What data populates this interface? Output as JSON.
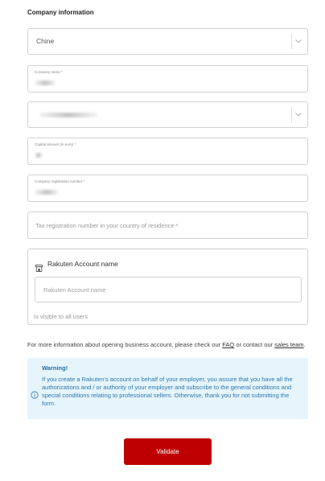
{
  "section_title": "Company information",
  "country_select": {
    "value": "Chine"
  },
  "company_name": {
    "label": "Company name *"
  },
  "legal_form_select": {},
  "capital_amount": {
    "label": "Capital amount (in euro) *"
  },
  "registration_number": {
    "label": "Company registration number *"
  },
  "tax_number": {
    "placeholder": "Tax registration number in your country of residence *"
  },
  "rakuten_account": {
    "title": "Rakuten Account name",
    "placeholder": "Rakuten Account name",
    "helper": "Is visible to all users"
  },
  "info": {
    "prefix": "For more information about opening business account, please check our ",
    "faq_link": "FAQ",
    "middle": " or contact our ",
    "sales_link": "sales team",
    "suffix": "."
  },
  "warning": {
    "title": "Warning!",
    "body": "If you create a Rakuten's account on behalf of your employer, you assure that you have all the authorizations and / or authority of your employer and subscribe to the general conditions and special conditions relating to professional sellers. Otherwise, thank you for not submitting the form.",
    "color": "#e6f4fc"
  },
  "validate_button": {
    "label": "Validate",
    "color": "#bf0000"
  }
}
